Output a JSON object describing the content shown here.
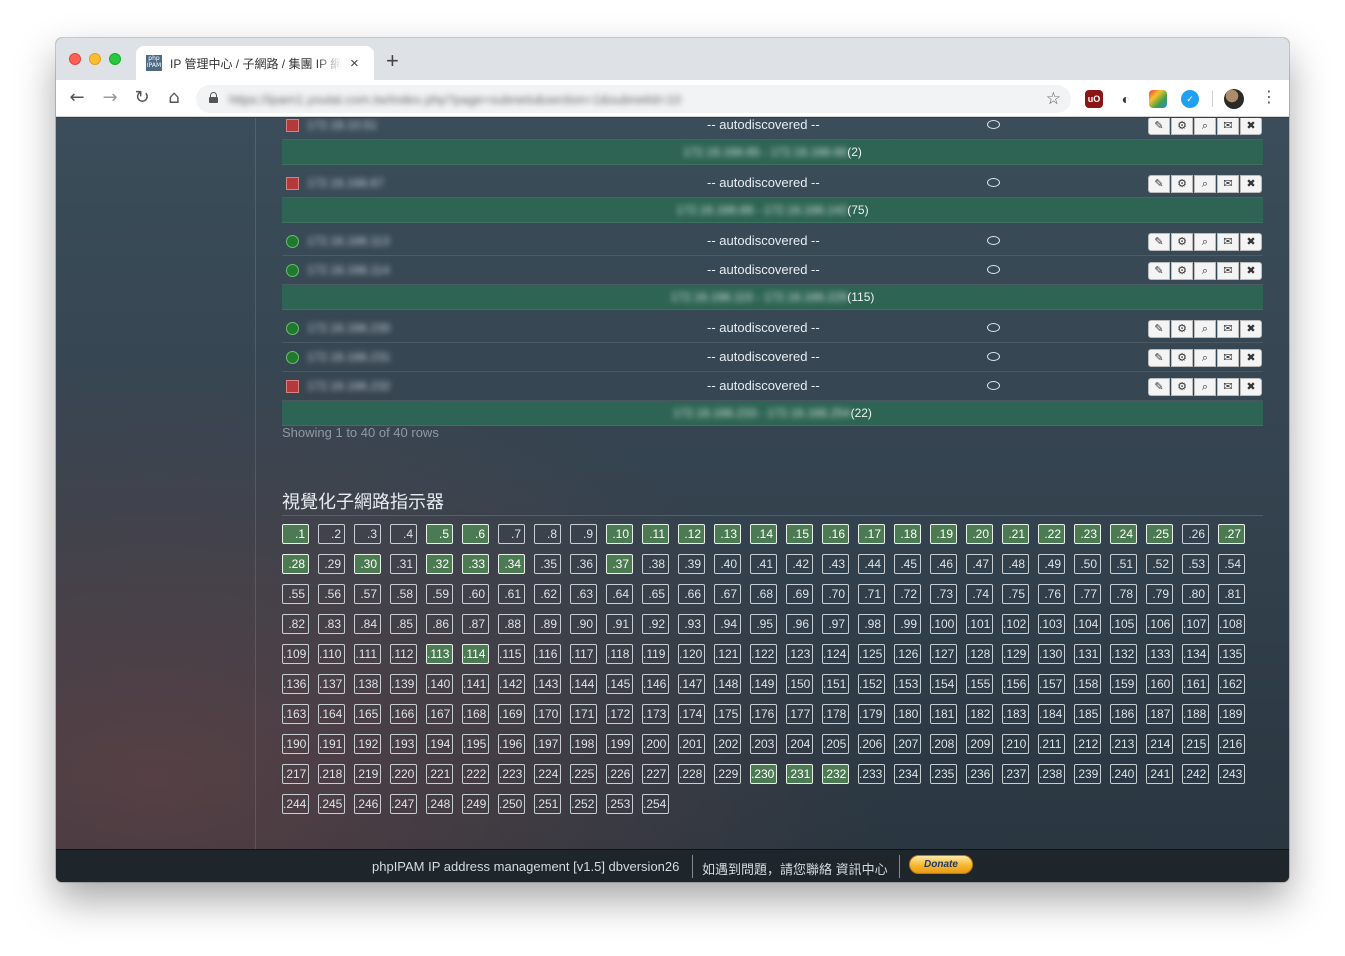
{
  "browser": {
    "tab_title": "IP 管理中心 / 子網路 / 集團 IP 網段",
    "favicon_text": "php IPAM",
    "close_symbol": "×",
    "new_tab_symbol": "+",
    "url": "https://ipam1.youtai.com.tw/index.php?page=subnets&section=1&subnetId=10",
    "icons": [
      "back-icon",
      "forward-icon",
      "reload-icon",
      "home-icon",
      "lock-icon",
      "star-icon",
      "ublock-icon",
      "extension-icon",
      "colorful-extension-icon",
      "blue-extension-icon",
      "avatar",
      "kebab-menu-icon"
    ]
  },
  "table": {
    "rows": [
      {
        "type": "addr",
        "status": "down",
        "ip": "172.18.10.51",
        "desc": "-- autodiscovered --",
        "partial": true
      },
      {
        "type": "free",
        "range": "172.16.166.65 - 172.16.166.66",
        "count": "(2)"
      },
      {
        "type": "addr",
        "status": "down",
        "ip": "172.16.166.67",
        "desc": "-- autodiscovered --"
      },
      {
        "type": "free",
        "range": "172.16.166.68 - 172.16.166.142",
        "count": "(75)"
      },
      {
        "type": "addr",
        "status": "up",
        "ip": "172.16.166.113",
        "desc": "-- autodiscovered --"
      },
      {
        "type": "addr",
        "status": "up",
        "ip": "172.16.166.114",
        "desc": "-- autodiscovered --"
      },
      {
        "type": "free",
        "range": "172.16.166.115 - 172.16.166.229",
        "count": "(115)"
      },
      {
        "type": "addr",
        "status": "up",
        "ip": "172.16.166.230",
        "desc": "-- autodiscovered --"
      },
      {
        "type": "addr",
        "status": "up",
        "ip": "172.16.166.231",
        "desc": "-- autodiscovered --"
      },
      {
        "type": "addr",
        "status": "down",
        "ip": "172.16.166.232",
        "desc": "-- autodiscovered --"
      },
      {
        "type": "free",
        "range": "172.16.166.233 - 172.16.166.254",
        "count": "(22)"
      }
    ],
    "actions": [
      {
        "name": "edit-icon",
        "glyph": "✎"
      },
      {
        "name": "cogs-icon",
        "glyph": "⚙"
      },
      {
        "name": "search-icon",
        "glyph": "⌕"
      },
      {
        "name": "envelope-icon",
        "glyph": "✉"
      },
      {
        "name": "delete-icon",
        "glyph": "✖"
      }
    ],
    "showing": "Showing 1 to 40 of 40 rows"
  },
  "viz": {
    "title": "視覺化子網路指示器",
    "max": 254,
    "per_row": 27,
    "used": [
      1,
      5,
      6,
      10,
      11,
      12,
      13,
      14,
      15,
      16,
      17,
      18,
      19,
      20,
      21,
      22,
      23,
      24,
      25,
      27,
      28,
      30,
      32,
      33,
      34,
      37,
      113,
      114,
      230,
      231,
      232
    ]
  },
  "footer": {
    "app": "phpIPAM IP address management [v1.5] dbversion26",
    "contact": "如遇到問題，請您聯絡 資訊中心",
    "donate": "Donate"
  },
  "colors": {
    "free_row": "#2e6454",
    "used_cell": "#4c7a52",
    "status_up": "#1f7a2e",
    "status_down": "#b23a3a",
    "footer_bg": "#1e262c"
  }
}
